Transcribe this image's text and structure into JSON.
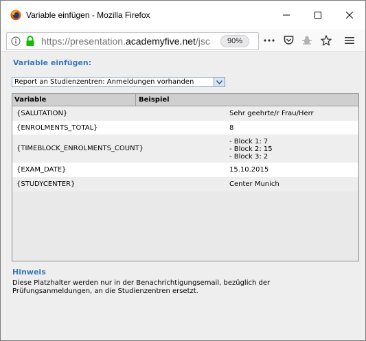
{
  "window": {
    "title": "Variable einfügen - Mozilla Firefox"
  },
  "urlbar": {
    "url_prefix": "https://presentation.",
    "url_domain": "academyfive.net",
    "url_suffix": "/jsc",
    "zoom": "90%"
  },
  "page": {
    "heading": "Variable einfügen:",
    "select_value": "Report an Studienzentren: Anmeldungen vorhanden",
    "table": {
      "columns": [
        "Variable",
        "Beispiel"
      ],
      "rows": [
        {
          "variable": "{SALUTATION}",
          "example": "Sehr geehrte/r Frau/Herr"
        },
        {
          "variable": "{ENROLMENTS_TOTAL}",
          "example": "8"
        },
        {
          "variable": "{TIMEBLOCK_ENROLMENTS_COUNT}",
          "example_lines": [
            "- Block 1: 7",
            "- Block 2: 15",
            "- Block 3: 2"
          ]
        },
        {
          "variable": "{EXAM_DATE}",
          "example": "15.10.2015"
        },
        {
          "variable": "{STUDYCENTER}",
          "example": "Center Munich"
        }
      ]
    },
    "hint_title": "Hinweis",
    "hint_text": "Diese Platzhalter werden nur in der Benachrichtigungsemail, bezüglich der Prüfungsanmeldungen, an die Studienzentren ersetzt."
  },
  "colors": {
    "heading_blue": "#3a79b9",
    "table_header": "#cfcfcf"
  }
}
